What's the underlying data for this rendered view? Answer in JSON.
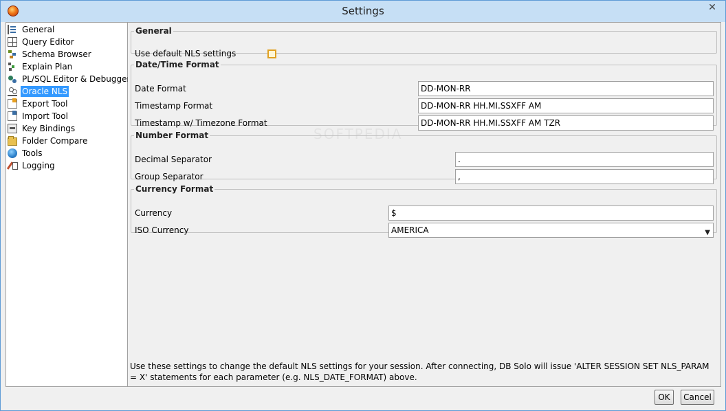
{
  "window": {
    "title": "Settings",
    "close_glyph": "✕"
  },
  "tree": {
    "items": [
      {
        "label": "General",
        "icon": "general-icon"
      },
      {
        "label": "Query Editor",
        "icon": "grid-icon"
      },
      {
        "label": "Schema Browser",
        "icon": "schema-icon"
      },
      {
        "label": "Explain Plan",
        "icon": "explain-plan-icon"
      },
      {
        "label": "PL/SQL Editor & Debugger",
        "icon": "plsql-icon"
      },
      {
        "label": "Oracle NLS",
        "icon": "nls-icon",
        "selected": true
      },
      {
        "label": "Export Tool",
        "icon": "export-icon"
      },
      {
        "label": "Import Tool",
        "icon": "import-icon"
      },
      {
        "label": "Key Bindings",
        "icon": "key-bindings-icon"
      },
      {
        "label": "Folder Compare",
        "icon": "folder-icon"
      },
      {
        "label": "Tools",
        "icon": "tools-globe-icon"
      },
      {
        "label": "Logging",
        "icon": "logging-icon"
      }
    ]
  },
  "general": {
    "legend": "General",
    "use_default_label": "Use default NLS settings",
    "use_default_checked": false
  },
  "datetime": {
    "legend": "Date/Time Format",
    "date_label": "Date Format",
    "date_value": "DD-MON-RR",
    "timestamp_label": "Timestamp Format",
    "timestamp_value": "DD-MON-RR HH.MI.SSXFF AM",
    "timestamp_tz_label": "Timestamp w/ Timezone Format",
    "timestamp_tz_value": "DD-MON-RR HH.MI.SSXFF AM TZR"
  },
  "number": {
    "legend": "Number Format",
    "decimal_label": "Decimal Separator",
    "decimal_value": ".",
    "group_label": "Group Separator",
    "group_value": ","
  },
  "currency": {
    "legend": "Currency Format",
    "currency_label": "Currency",
    "currency_value": "$",
    "iso_label": "ISO Currency",
    "iso_value": "AMERICA"
  },
  "footer": {
    "note": "Use these settings to change the default NLS settings for your session. After connecting, DB Solo will issue 'ALTER SESSION SET NLS_PARAM = X' statements for each parameter (e.g. NLS_DATE_FORMAT) above."
  },
  "buttons": {
    "ok": "OK",
    "cancel": "Cancel"
  },
  "colors": {
    "selection": "#3399ff",
    "title_bar": "#c6dff5",
    "window_border": "#5d9bd6"
  }
}
